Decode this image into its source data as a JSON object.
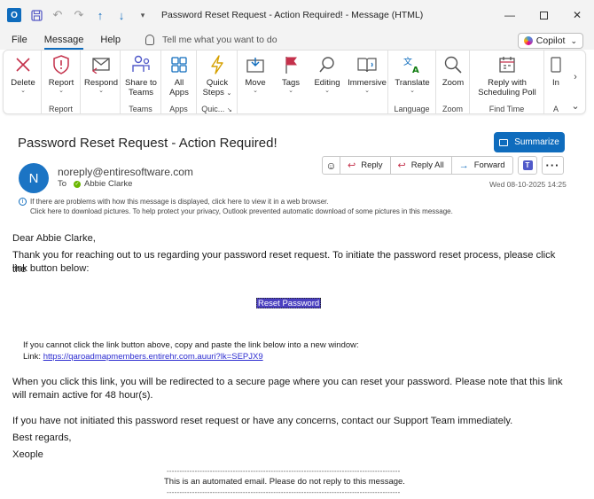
{
  "window": {
    "title": "Password Reset Request - Action Required!  -  Message (HTML)",
    "app_icon": "outlook-icon",
    "controls": [
      "minimize",
      "restore",
      "close"
    ]
  },
  "menubar": {
    "tabs": [
      "File",
      "Message",
      "Help"
    ],
    "active_tab": "Message",
    "tell_me": "Tell me what you want to do",
    "copilot_label": "Copilot"
  },
  "ribbon": {
    "buttons": {
      "delete": "Delete",
      "report": "Report",
      "respond": "Respond",
      "share_teams_1": "Share to",
      "share_teams_2": "Teams",
      "all_apps_1": "All",
      "all_apps_2": "Apps",
      "quick_steps_1": "Quick",
      "quick_steps_2": "Steps",
      "move": "Move",
      "tags": "Tags",
      "editing": "Editing",
      "immersive": "Immersive",
      "translate": "Translate",
      "zoom": "Zoom",
      "reply_sched_1": "Reply with",
      "reply_sched_2": "Scheduling Poll",
      "insights_partial": "In"
    },
    "groups": {
      "report": "Report",
      "teams": "Teams",
      "apps": "Apps",
      "quick": "Quic...",
      "language": "Language",
      "zoom": "Zoom",
      "find_time": "Find Time",
      "partial": "A"
    }
  },
  "message": {
    "subject": "Password Reset Request - Action Required!",
    "summarize": "Summarize",
    "avatar_initial": "N",
    "sender": "noreply@entiresoftware.com",
    "to_label": "To",
    "recipient": "Abbie Clarke",
    "date": "Wed 08-10-2025 14:25",
    "actions": {
      "reply": "Reply",
      "reply_all": "Reply All",
      "forward": "Forward"
    },
    "info_line_1": "If there are problems with how this message is displayed, click here to view it in a web browser.",
    "info_line_2": "Click here to download pictures. To help protect your privacy, Outlook prevented automatic download of some pictures in this message."
  },
  "body": {
    "greeting": "Dear Abbie Clarke,",
    "para1_l1": "Thank you for reaching out to us regarding your password reset request. To initiate the password reset process, please click the",
    "para1_l2": "link button below:",
    "reset_button": "Reset Password",
    "fallback_l1": "If you cannot click the link button above, copy and paste the link below into a new window:",
    "fallback_link_label": "Link: ",
    "fallback_link": "https://qaroadmapmembers.entirehr.com.auuri?lk=SEPJX9",
    "para2_l1": "When you click this link, you will be redirected to a secure page where you can reset your password. Please note that this link",
    "para2_l2": "will remain active for 48 hour(s).",
    "para3": "If you have not initiated this password reset request or have any concerns, contact our Support Team immediately.",
    "regards": "Best regards,",
    "signature": "Xeople",
    "divider": "--------------------------------------------------------------------------------------------",
    "footer": "This is an automated email. Please do not reply to this message."
  }
}
